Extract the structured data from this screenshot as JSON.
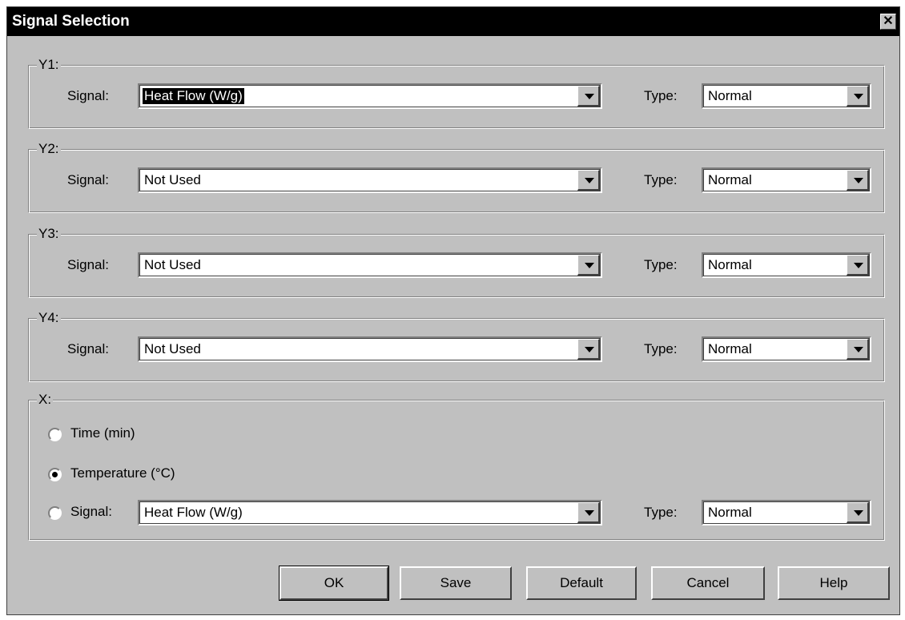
{
  "window": {
    "title": "Signal Selection",
    "close_glyph": "✕"
  },
  "groups": [
    {
      "label": "Y1:",
      "signal_label": "Signal:",
      "signal_value": "Heat Flow (W/g)",
      "type_label": "Type:",
      "type_value": "Normal"
    },
    {
      "label": "Y2:",
      "signal_label": "Signal:",
      "signal_value": "Not Used",
      "type_label": "Type:",
      "type_value": "Normal"
    },
    {
      "label": "Y3:",
      "signal_label": "Signal:",
      "signal_value": "Not Used",
      "type_label": "Type:",
      "type_value": "Normal"
    },
    {
      "label": "Y4:",
      "signal_label": "Signal:",
      "signal_value": "Not Used",
      "type_label": "Type:",
      "type_value": "Normal"
    }
  ],
  "x": {
    "label": "X:",
    "radio_time": "Time (min)",
    "radio_temperature": "Temperature (°C)",
    "radio_signal": "Signal:",
    "selected": "temperature",
    "signal_value": "Heat Flow (W/g)",
    "type_label": "Type:",
    "type_value": "Normal"
  },
  "buttons": {
    "ok": "OK",
    "save": "Save",
    "default": "Default",
    "cancel": "Cancel",
    "help": "Help"
  }
}
